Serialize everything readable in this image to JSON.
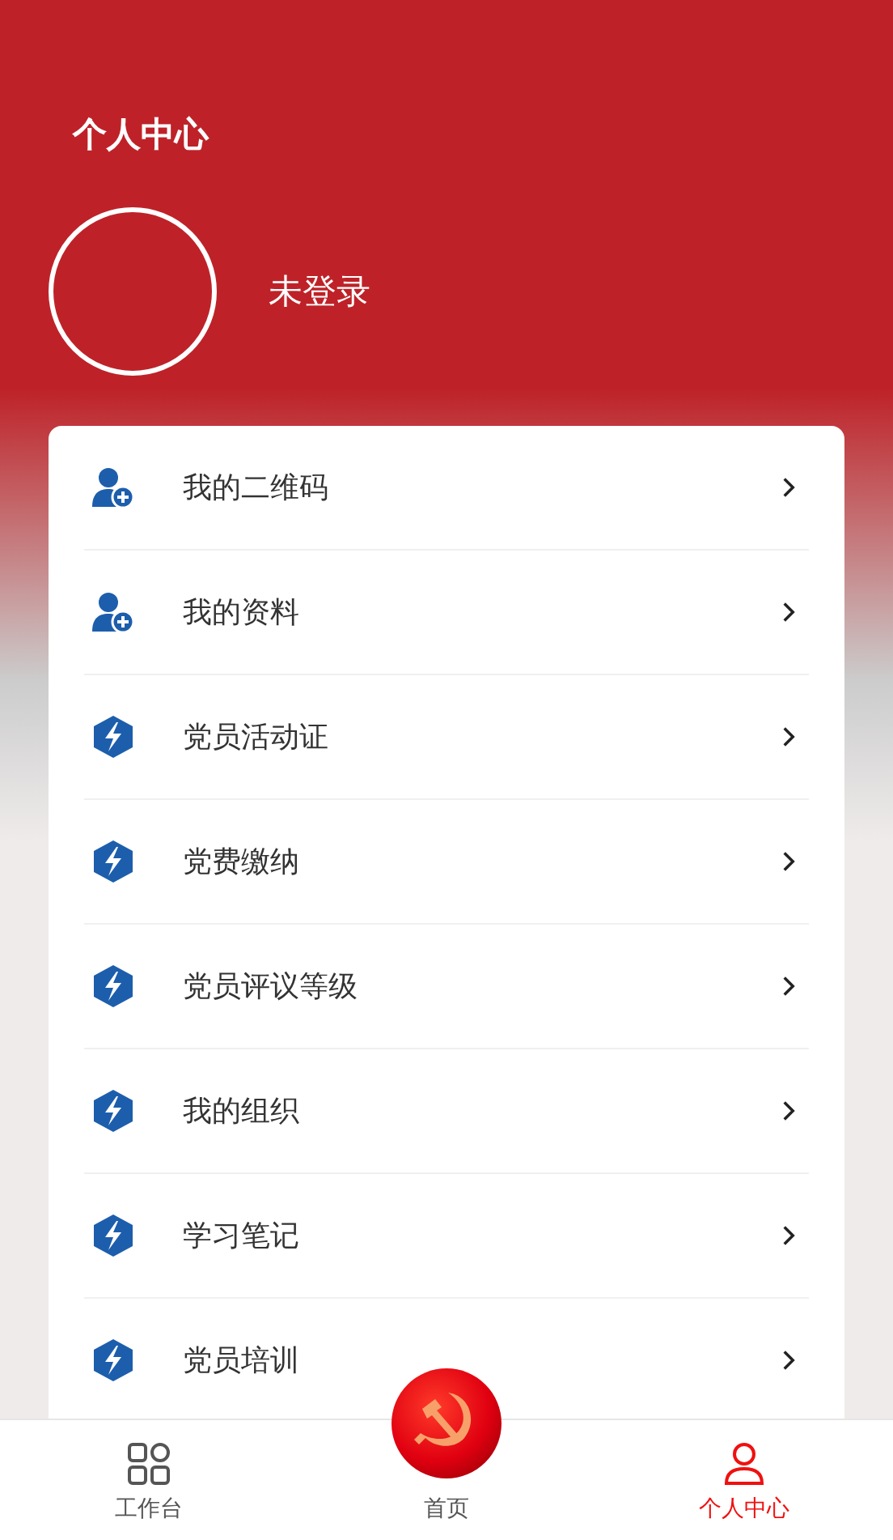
{
  "header": {
    "title": "个人中心"
  },
  "profile": {
    "name": "未登录"
  },
  "menu": [
    {
      "label": "我的二维码",
      "kind": "user"
    },
    {
      "label": "我的资料",
      "kind": "user"
    },
    {
      "label": "党员活动证",
      "kind": "bolt"
    },
    {
      "label": "党费缴纳",
      "kind": "bolt"
    },
    {
      "label": "党员评议等级",
      "kind": "bolt"
    },
    {
      "label": "我的组织",
      "kind": "bolt"
    },
    {
      "label": "学习笔记",
      "kind": "bolt"
    },
    {
      "label": "党员培训",
      "kind": "bolt"
    }
  ],
  "tab_bar": [
    {
      "label": "工作台",
      "kind": "grid",
      "selected": false
    },
    {
      "label": "首页",
      "kind": "home",
      "selected": false
    },
    {
      "label": "个人中心",
      "kind": "person",
      "selected": true
    }
  ]
}
